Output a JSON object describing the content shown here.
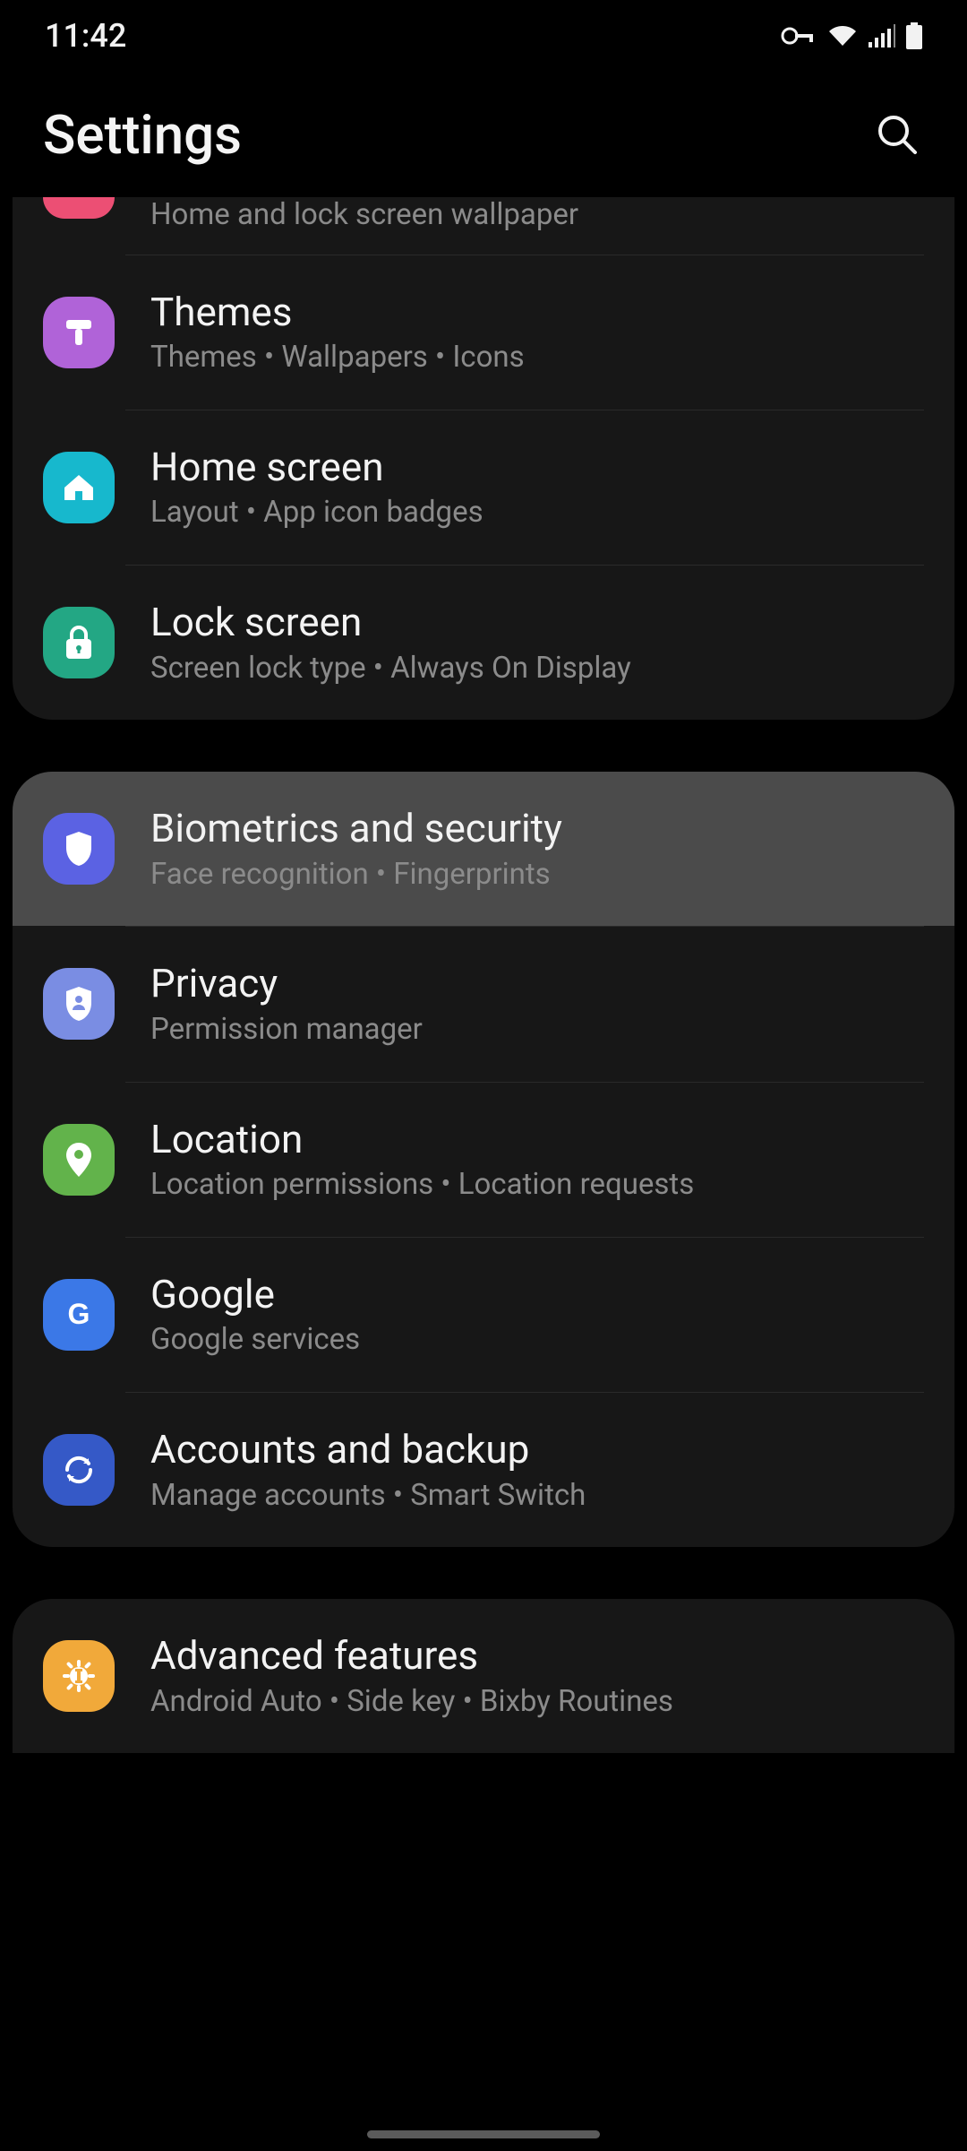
{
  "status": {
    "time": "11:42"
  },
  "header": {
    "title": "Settings"
  },
  "groups": [
    {
      "items": [
        {
          "id": "wallpaper",
          "title": "",
          "subtitle": "Home and lock screen wallpaper",
          "iconColor": "#ec4f74",
          "partialTop": true
        },
        {
          "id": "themes",
          "title": "Themes",
          "subtitle": "Themes  •  Wallpapers  •  Icons",
          "iconColor": "#b063d8"
        },
        {
          "id": "home-screen",
          "title": "Home screen",
          "subtitle": "Layout  •  App icon badges",
          "iconColor": "#17b8cd"
        },
        {
          "id": "lock-screen",
          "title": "Lock screen",
          "subtitle": "Screen lock type  •  Always On Display",
          "iconColor": "#23a784"
        }
      ]
    },
    {
      "items": [
        {
          "id": "biometrics",
          "title": "Biometrics and security",
          "subtitle": "Face recognition  •  Fingerprints",
          "iconColor": "#5b62e3",
          "highlight": true
        },
        {
          "id": "privacy",
          "title": "Privacy",
          "subtitle": "Permission manager",
          "iconColor": "#7a8de3"
        },
        {
          "id": "location",
          "title": "Location",
          "subtitle": "Location permissions  •  Location requests",
          "iconColor": "#62b34b"
        },
        {
          "id": "google",
          "title": "Google",
          "subtitle": "Google services",
          "iconColor": "#3b78e7"
        },
        {
          "id": "accounts",
          "title": "Accounts and backup",
          "subtitle": "Manage accounts  •  Smart Switch",
          "iconColor": "#3559c7"
        }
      ]
    },
    {
      "items": [
        {
          "id": "advanced",
          "title": "Advanced features",
          "subtitle": "Android Auto  •  Side key  •  Bixby Routines",
          "iconColor": "#f1a93a"
        }
      ]
    }
  ]
}
